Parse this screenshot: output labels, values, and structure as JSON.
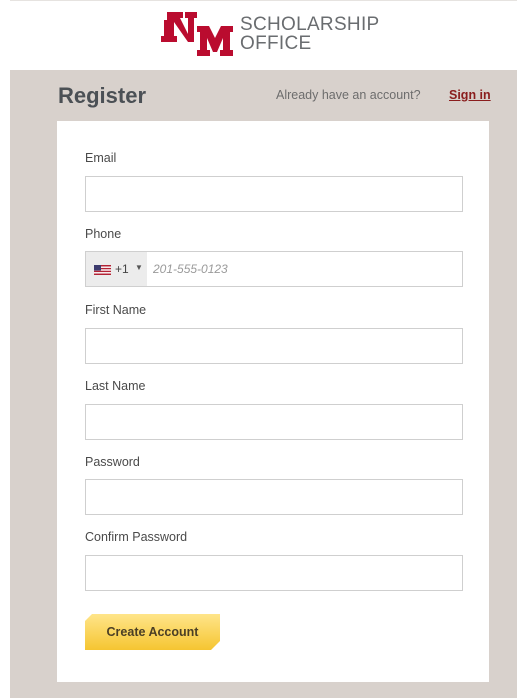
{
  "header": {
    "title_line1": "SCHOLARSHIP",
    "title_line2": "OFFICE",
    "logo_icon": "unm-logo-icon"
  },
  "register": {
    "title": "Register",
    "already_text": "Already have an account?",
    "signin_label": "Sign in"
  },
  "form": {
    "email_label": "Email",
    "email_value": "",
    "phone_label": "Phone",
    "country_flag_icon": "us-flag-icon",
    "dial_code": "+1",
    "phone_placeholder": "201-555-0123",
    "phone_value": "",
    "first_name_label": "First Name",
    "first_name_value": "",
    "last_name_label": "Last Name",
    "last_name_value": "",
    "password_label": "Password",
    "password_value": "",
    "confirm_password_label": "Confirm Password",
    "confirm_password_value": "",
    "submit_label": "Create Account"
  },
  "colors": {
    "brand_red": "#ba0c2f",
    "panel_bg": "#d8d1cc",
    "button_gold": "#f5c531",
    "link": "#8a1d1d"
  }
}
